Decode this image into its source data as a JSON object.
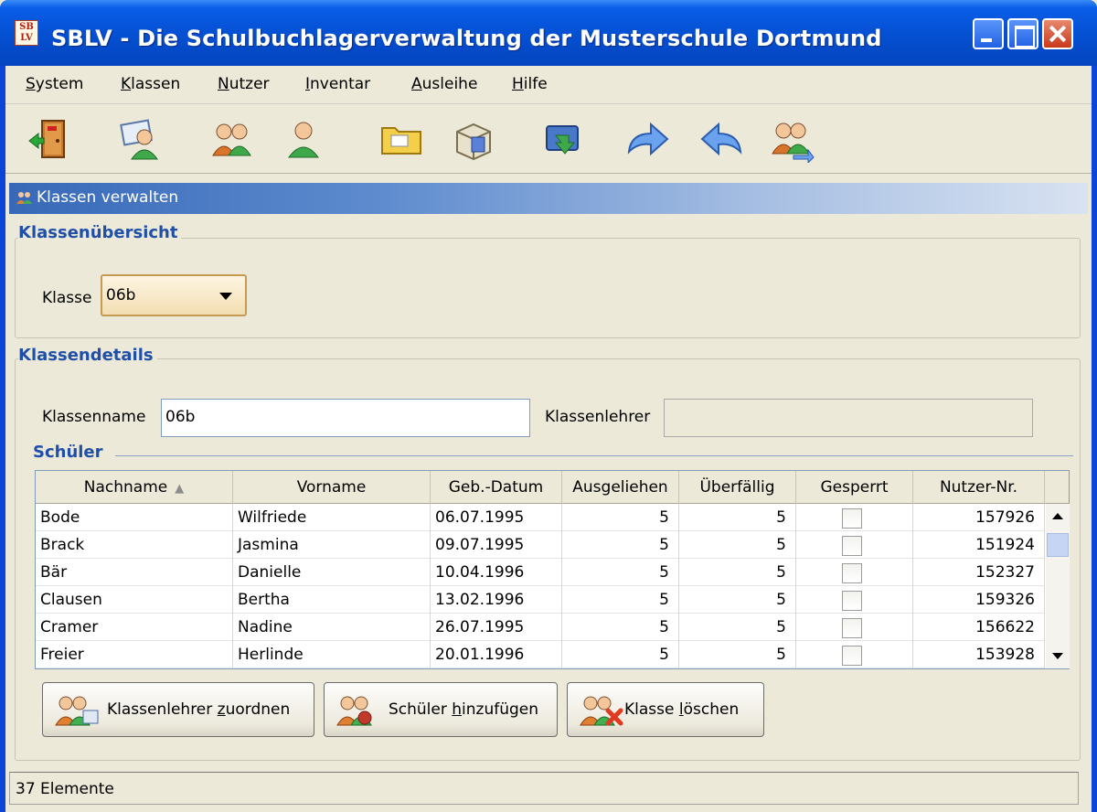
{
  "window": {
    "title": "SBLV - Die Schulbuchlagerverwaltung der Musterschule Dortmund",
    "icon_text_top": "SB",
    "icon_text_bottom": "LV"
  },
  "menu": [
    {
      "label_u": "S",
      "label_rest": "ystem"
    },
    {
      "label_u": "K",
      "label_rest": "lassen"
    },
    {
      "label_u": "N",
      "label_rest": "utzer"
    },
    {
      "label_u": "I",
      "label_rest": "nventar"
    },
    {
      "label_u": "A",
      "label_rest": "usleihe"
    },
    {
      "label_u": "H",
      "label_rest": "ilfe"
    }
  ],
  "toolbar_icons": [
    "exit-door-icon",
    "user-card-icon",
    "class-users-icon",
    "single-user-icon",
    "folder-icon",
    "inventory-icon",
    "book-return-icon",
    "arrow-forward-icon",
    "arrow-back-icon",
    "users-exchange-icon"
  ],
  "panel": {
    "title": "Klassen verwalten"
  },
  "overview": {
    "group_title": "Klassenübersicht",
    "class_label": "Klasse",
    "class_value": "06b"
  },
  "details": {
    "group_title": "Klassendetails",
    "name_label": "Klassenname",
    "name_value": "06b",
    "teacher_label": "Klassenlehrer",
    "teacher_value": "",
    "students_title": "Schüler"
  },
  "table": {
    "columns": [
      "Nachname",
      "Vorname",
      "Geb.-Datum",
      "Ausgeliehen",
      "Überfällig",
      "Gesperrt",
      "Nutzer-Nr."
    ],
    "sort_indicator": "▲",
    "rows": [
      {
        "nachname": "Bode",
        "vorname": "Wilfriede",
        "datum": "06.07.1995",
        "ausgeliehen": "5",
        "ueberfaellig": "5",
        "gesperrt": false,
        "nr": "157926"
      },
      {
        "nachname": "Brack",
        "vorname": "Jasmina",
        "datum": "09.07.1995",
        "ausgeliehen": "5",
        "ueberfaellig": "5",
        "gesperrt": false,
        "nr": "151924"
      },
      {
        "nachname": "Bär",
        "vorname": "Danielle",
        "datum": "10.04.1996",
        "ausgeliehen": "5",
        "ueberfaellig": "5",
        "gesperrt": false,
        "nr": "152327"
      },
      {
        "nachname": "Clausen",
        "vorname": "Bertha",
        "datum": "13.02.1996",
        "ausgeliehen": "5",
        "ueberfaellig": "5",
        "gesperrt": false,
        "nr": "159326"
      },
      {
        "nachname": "Cramer",
        "vorname": "Nadine",
        "datum": "26.07.1995",
        "ausgeliehen": "5",
        "ueberfaellig": "5",
        "gesperrt": false,
        "nr": "156622"
      },
      {
        "nachname": "Freier",
        "vorname": "Herlinde",
        "datum": "20.01.1996",
        "ausgeliehen": "5",
        "ueberfaellig": "5",
        "gesperrt": false,
        "nr": "153928"
      }
    ]
  },
  "buttons": {
    "assign_teacher_pre": "Klassenlehrer ",
    "assign_teacher_u": "z",
    "assign_teacher_post": "uordnen",
    "add_students_pre": "Schüler ",
    "add_students_u": "h",
    "add_students_post": "inzufügen",
    "delete_class_pre": "Klasse ",
    "delete_class_u": "l",
    "delete_class_post": "öschen"
  },
  "status": {
    "text": "37 Elemente"
  }
}
